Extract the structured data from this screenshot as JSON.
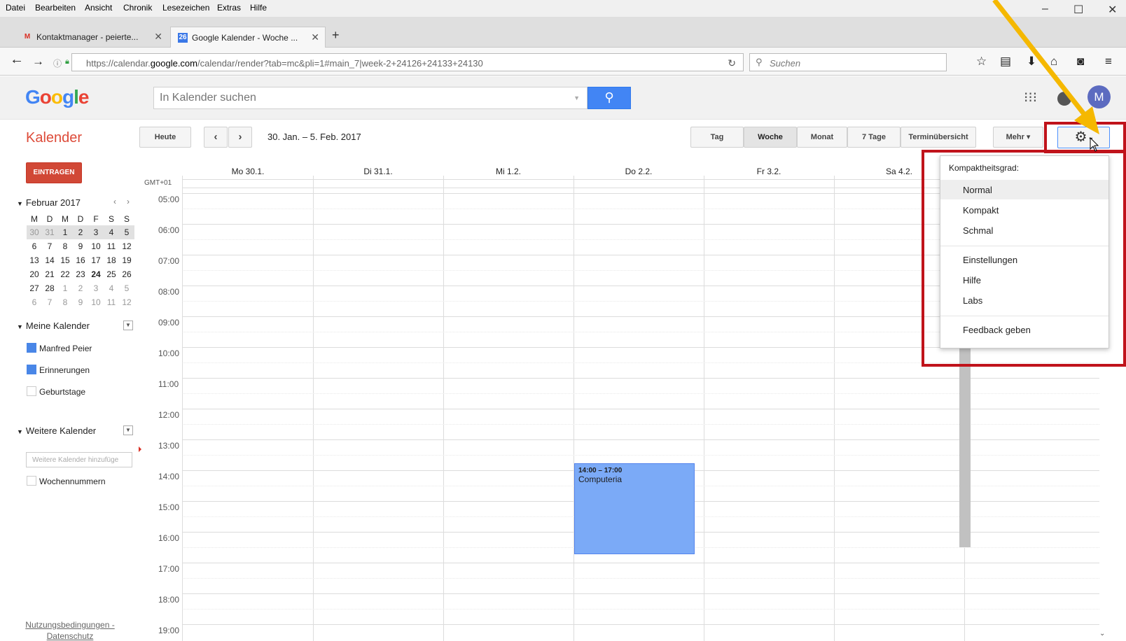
{
  "browser": {
    "menu": [
      "Datei",
      "Bearbeiten",
      "Ansicht",
      "Chronik",
      "Lesezeichen",
      "Extras",
      "Hilfe"
    ],
    "tabs": [
      {
        "label": "Kontaktmanager - peierte...",
        "favicon": "M"
      },
      {
        "label": "Google Kalender - Woche ...",
        "favicon": "26"
      }
    ],
    "url_prefix": "https://calendar.",
    "url_domain": "google.com",
    "url_suffix": "/calendar/render?tab=mc&pli=1#main_7|week-2+24126+24133+24130",
    "search_placeholder": "Suchen"
  },
  "google": {
    "logo": "Google",
    "search_placeholder": "In Kalender suchen",
    "avatar": "M"
  },
  "toolbar": {
    "title": "Kalender",
    "today": "Heute",
    "date_range": "30. Jan. – 5. Feb. 2017",
    "views": [
      "Tag",
      "Woche",
      "Monat",
      "7 Tage",
      "Terminübersicht"
    ],
    "more": "Mehr ▾"
  },
  "left": {
    "create": "EINTRAGEN",
    "month_title": "Februar 2017",
    "weekday_headers": [
      "M",
      "D",
      "M",
      "D",
      "F",
      "S",
      "S"
    ],
    "weeks": [
      [
        "30",
        "31",
        "1",
        "2",
        "3",
        "4",
        "5"
      ],
      [
        "6",
        "7",
        "8",
        "9",
        "10",
        "11",
        "12"
      ],
      [
        "13",
        "14",
        "15",
        "16",
        "17",
        "18",
        "19"
      ],
      [
        "20",
        "21",
        "22",
        "23",
        "24",
        "25",
        "26"
      ],
      [
        "27",
        "28",
        "1",
        "2",
        "3",
        "4",
        "5"
      ],
      [
        "6",
        "7",
        "8",
        "9",
        "10",
        "11",
        "12"
      ]
    ],
    "my_calendars_title": "Meine Kalender",
    "my_calendars": [
      {
        "name": "Manfred Peier",
        "color": "#4986e7"
      },
      {
        "name": "Erinnerungen",
        "color": "#4986e7"
      },
      {
        "name": "Geburtstage",
        "color": ""
      }
    ],
    "other_calendars_title": "Weitere Kalender",
    "add_placeholder": "Weitere Kalender hinzufüge",
    "other_calendars": [
      {
        "name": "Wochennummern"
      }
    ],
    "footer_terms": "Nutzungsbedingungen -",
    "footer_privacy": "Datenschutz"
  },
  "grid": {
    "timezone": "GMT+01",
    "days": [
      "Mo 30.1.",
      "Di 31.1.",
      "Mi 1.2.",
      "Do 2.2.",
      "Fr 3.2.",
      "Sa 4.2."
    ],
    "hours": [
      "05:00",
      "06:00",
      "07:00",
      "08:00",
      "09:00",
      "10:00",
      "11:00",
      "12:00",
      "13:00",
      "14:00",
      "15:00",
      "16:00",
      "17:00",
      "18:00",
      "19:00"
    ],
    "event": {
      "time": "14:00 – 17:00",
      "title": "Computeria",
      "color": "#7baaf7"
    }
  },
  "settings_menu": {
    "header": "Kompaktheitsgrad:",
    "density": [
      "Normal",
      "Kompakt",
      "Schmal"
    ],
    "items": [
      "Einstellungen",
      "Hilfe",
      "Labs"
    ],
    "feedback": "Feedback geben"
  },
  "annotation_color": "#c0131b",
  "arrow_color": "#f5b800"
}
